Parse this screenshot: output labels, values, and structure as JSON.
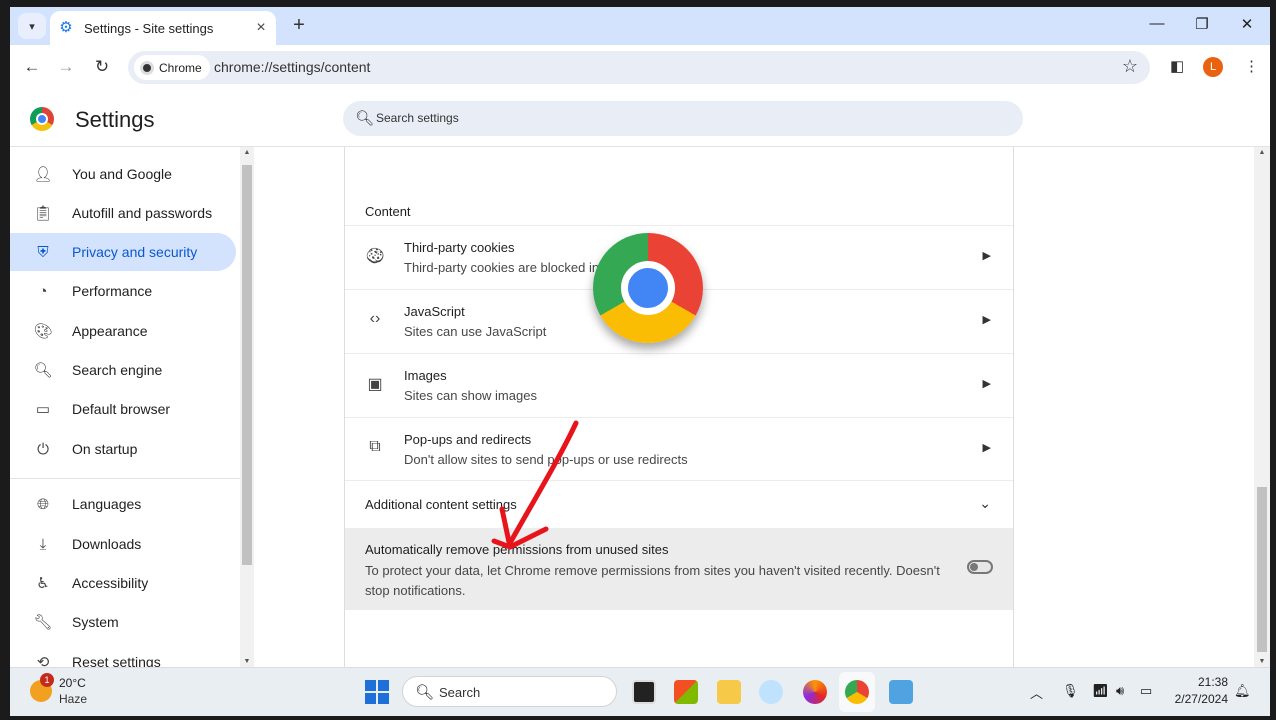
{
  "browser": {
    "tab_title": "Settings - Site settings",
    "chip_label": "Chrome",
    "url": "chrome://settings/content",
    "profile_initial": "L"
  },
  "header": {
    "title": "Settings",
    "search_placeholder": "Search settings"
  },
  "sidebar": {
    "items": [
      {
        "label": "You and Google",
        "icon": "person-icon"
      },
      {
        "label": "Autofill and passwords",
        "icon": "clipboard-icon"
      },
      {
        "label": "Privacy and security",
        "icon": "shield-icon",
        "active": true
      },
      {
        "label": "Performance",
        "icon": "speedometer-icon"
      },
      {
        "label": "Appearance",
        "icon": "palette-icon"
      },
      {
        "label": "Search engine",
        "icon": "search-icon"
      },
      {
        "label": "Default browser",
        "icon": "browser-window-icon"
      },
      {
        "label": "On startup",
        "icon": "power-icon"
      },
      {
        "label": "Languages",
        "icon": "globe-icon"
      },
      {
        "label": "Downloads",
        "icon": "download-icon"
      },
      {
        "label": "Accessibility",
        "icon": "accessibility-icon"
      },
      {
        "label": "System",
        "icon": "wrench-icon"
      },
      {
        "label": "Reset settings",
        "icon": "reset-icon"
      }
    ]
  },
  "content": {
    "section_title": "Content",
    "rows": [
      {
        "title": "Third-party cookies",
        "subtitle": "Third-party cookies are blocked in",
        "icon": "cookie-icon"
      },
      {
        "title": "JavaScript",
        "subtitle": "Sites can use JavaScript",
        "icon": "code-icon"
      },
      {
        "title": "Images",
        "subtitle": "Sites can show images",
        "icon": "image-icon"
      },
      {
        "title": "Pop-ups and redirects",
        "subtitle": "Don't allow sites to send pop-ups or use redirects",
        "icon": "open-in-new-icon"
      }
    ],
    "additional_label": "Additional content settings",
    "auto_remove": {
      "title": "Automatically remove permissions from unused sites",
      "description": "To protect your data, let Chrome remove permissions from sites you haven't visited recently. Doesn't stop notifications.",
      "enabled": false
    }
  },
  "taskbar": {
    "weather_temp": "20°C",
    "weather_desc": "Haze",
    "weather_badge": "1",
    "search_label": "Search",
    "time": "21:38",
    "date": "2/27/2024"
  },
  "colors": {
    "accent": "#0b57d0",
    "active_bg": "#d3e3fd",
    "arrow_red": "#e8141b"
  }
}
